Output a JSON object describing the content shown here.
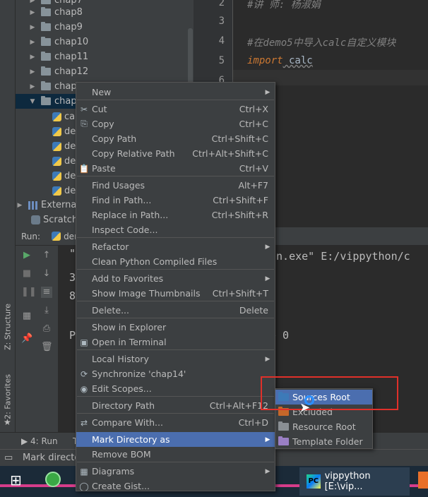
{
  "project_tree": {
    "items": [
      {
        "label": "chap7",
        "type": "folder",
        "expanded": false
      },
      {
        "label": "chap8",
        "type": "folder",
        "expanded": false
      },
      {
        "label": "chap9",
        "type": "folder",
        "expanded": false
      },
      {
        "label": "chap10",
        "type": "folder",
        "expanded": false
      },
      {
        "label": "chap11",
        "type": "folder",
        "expanded": false
      },
      {
        "label": "chap12",
        "type": "folder",
        "expanded": false
      },
      {
        "label": "chap13",
        "type": "folder",
        "expanded": false
      },
      {
        "label": "chap14",
        "type": "folder",
        "expanded": true,
        "selected": true
      },
      {
        "label": "calc",
        "type": "py"
      },
      {
        "label": "demo1",
        "type": "py"
      },
      {
        "label": "demo2",
        "type": "py"
      },
      {
        "label": "demo3",
        "type": "py"
      },
      {
        "label": "demo4",
        "type": "py"
      },
      {
        "label": "demo5",
        "type": "py"
      },
      {
        "label": "External Libraries",
        "type": "lib"
      },
      {
        "label": "Scratches and Consoles",
        "type": "scratch"
      }
    ]
  },
  "editor": {
    "lines": [
      {
        "num": "2",
        "text": "#讲    师: 杨淑娟",
        "style": "comment"
      },
      {
        "num": "3",
        "text": "",
        "style": "plain"
      },
      {
        "num": "4",
        "text": "#在demo5中导入calc自定义模块",
        "style": "comment"
      },
      {
        "num": "5",
        "text_kw": "import",
        "text_rest": " calc",
        "style": "import"
      },
      {
        "num": "6",
        "text": "",
        "style": "plain"
      }
    ]
  },
  "run_panel": {
    "header_label": "Run:",
    "tab_label": "demo5",
    "console_lines": [
      "\"",
      "3",
      "8",
      "P"
    ],
    "console_right_line1": "on.exe\" E:/vippython/c",
    "console_right_line2": "e 0"
  },
  "side_tabs": {
    "structure": "Z: Structure",
    "favorites": "2: Favorites"
  },
  "bottom_tabs": {
    "run_tab": "4: Run",
    "other_tab": "T"
  },
  "status_bar": {
    "text": "Mark directory as"
  },
  "context_menu": {
    "items": [
      {
        "label": "New",
        "shortcut": "",
        "submenu": true,
        "icon": ""
      },
      {
        "label": "Cut",
        "shortcut": "Ctrl+X",
        "icon": "✂"
      },
      {
        "label": "Copy",
        "shortcut": "Ctrl+C",
        "icon": "⎘"
      },
      {
        "label": "Copy Path",
        "shortcut": "Ctrl+Shift+C",
        "icon": ""
      },
      {
        "label": "Copy Relative Path",
        "shortcut": "Ctrl+Alt+Shift+C",
        "icon": ""
      },
      {
        "label": "Paste",
        "shortcut": "Ctrl+V",
        "icon": "📋"
      },
      {
        "label": "Find Usages",
        "shortcut": "Alt+F7",
        "icon": ""
      },
      {
        "label": "Find in Path...",
        "shortcut": "Ctrl+Shift+F",
        "icon": ""
      },
      {
        "label": "Replace in Path...",
        "shortcut": "Ctrl+Shift+R",
        "icon": ""
      },
      {
        "label": "Inspect Code...",
        "shortcut": "",
        "icon": ""
      },
      {
        "label": "Refactor",
        "shortcut": "",
        "submenu": true,
        "icon": ""
      },
      {
        "label": "Clean Python Compiled Files",
        "shortcut": "",
        "icon": ""
      },
      {
        "label": "Add to Favorites",
        "shortcut": "",
        "submenu": true,
        "icon": ""
      },
      {
        "label": "Show Image Thumbnails",
        "shortcut": "Ctrl+Shift+T",
        "icon": ""
      },
      {
        "label": "Delete...",
        "shortcut": "Delete",
        "icon": ""
      },
      {
        "label": "Show in Explorer",
        "shortcut": "",
        "icon": ""
      },
      {
        "label": "Open in Terminal",
        "shortcut": "",
        "icon": "▣"
      },
      {
        "label": "Local History",
        "shortcut": "",
        "submenu": true,
        "icon": ""
      },
      {
        "label": "Synchronize 'chap14'",
        "shortcut": "",
        "icon": "⟳"
      },
      {
        "label": "Edit Scopes...",
        "shortcut": "",
        "icon": "◉"
      },
      {
        "label": "Directory Path",
        "shortcut": "Ctrl+Alt+F12",
        "icon": ""
      },
      {
        "label": "Compare With...",
        "shortcut": "Ctrl+D",
        "icon": "⇄"
      },
      {
        "label": "Mark Directory as",
        "shortcut": "",
        "submenu": true,
        "active": true,
        "icon": ""
      },
      {
        "label": "Remove BOM",
        "shortcut": "",
        "icon": ""
      },
      {
        "label": "Diagrams",
        "shortcut": "",
        "submenu": true,
        "icon": "▦"
      },
      {
        "label": "Create Gist...",
        "shortcut": "",
        "icon": "◯"
      }
    ]
  },
  "sub_menu": {
    "items": [
      {
        "label": "Sources Root",
        "color": "#3d7ab8",
        "active": true
      },
      {
        "label": "Excluded",
        "color": "#c5672a"
      },
      {
        "label": "Resource Root",
        "color": "#8a8f94"
      },
      {
        "label": "Template Folder",
        "color": "#9a7fc4"
      }
    ]
  },
  "taskbar": {
    "app_label": "vippython [E:\\vip..."
  },
  "colors": {
    "menu_active": "#4b6eaf",
    "highlight_box": "#e0302a",
    "taskbar_accent": "#d63c8a"
  }
}
